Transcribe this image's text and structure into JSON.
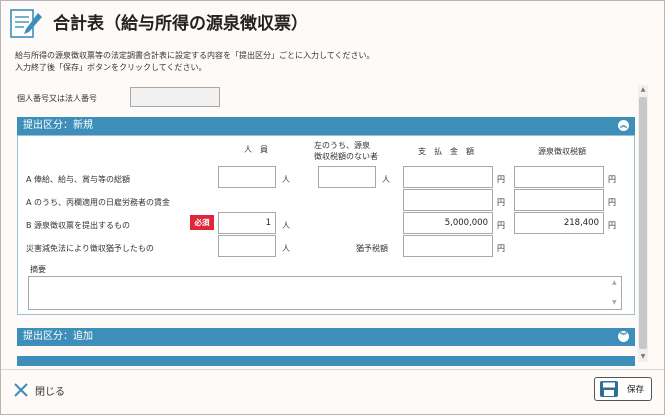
{
  "header": {
    "title": "合計表（給与所得の源泉徴収票）",
    "desc_line1": "給与所得の源泉徴収票等の法定調書合計表に設定する内容を「提出区分」ごとに入力してください。",
    "desc_line2": "入力終了後「保存」ボタンをクリックしてください。"
  },
  "id_field": {
    "label": "個人番号又は法人番号",
    "value": ""
  },
  "sections": [
    {
      "title": "提出区分：新規",
      "chevron": "up"
    },
    {
      "title": "提出区分：追加",
      "chevron": "down"
    }
  ],
  "columns": {
    "people": "人　員",
    "other_line1": "左のうち、源泉",
    "other_line2": "徴収税額のない者",
    "amount": "支　払　金　額",
    "tax": "源泉徴収税額"
  },
  "units": {
    "person": "人",
    "yen": "円"
  },
  "rows": {
    "a1": {
      "label": "A 俸給、給与、賞与等の総額",
      "people": "",
      "no_tax": "",
      "amount": "",
      "tax": ""
    },
    "a2": {
      "label": "A のうち、丙欄適用の日雇労務者の賃金",
      "amount": "",
      "tax": ""
    },
    "b": {
      "label": "B 源泉徴収票を提出するもの",
      "required": "必須",
      "people": "1",
      "amount": "5,000,000",
      "tax": "218,400"
    },
    "disaster": {
      "label": "災害減免法により徴収猶予したもの",
      "people": "",
      "deferred_label": "猶予税額",
      "deferred": ""
    }
  },
  "remarks": {
    "label": "摘要",
    "value": ""
  },
  "footer": {
    "close_label": "閉じる",
    "save_label": "保存"
  },
  "colors": {
    "accent": "#3d8fb9",
    "required": "#e0263a"
  }
}
